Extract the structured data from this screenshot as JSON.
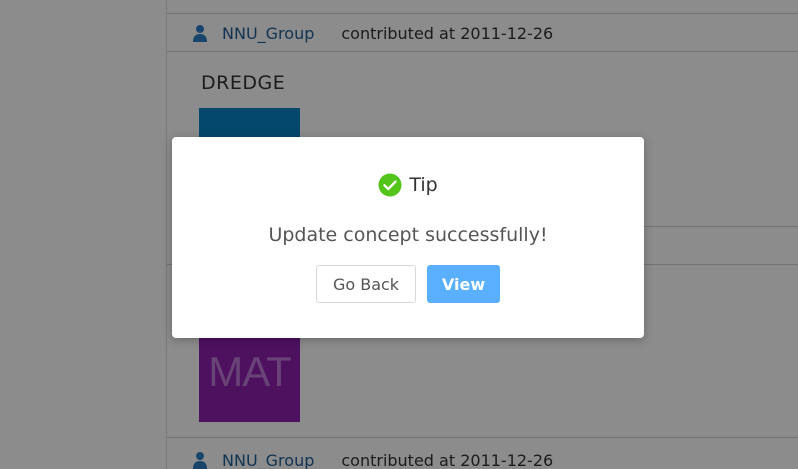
{
  "contributions": [
    {
      "user": "NNU_Group",
      "text": "contributed at 2011-12-26"
    },
    {
      "user": "NNU_Group",
      "text": "contributed at 2011-12-26"
    }
  ],
  "concept": {
    "title": "DREDGE",
    "thumb_blue_color": "#0a84c6",
    "thumb_purple_color": "#8c1fb0",
    "thumb_purple_label": "MAT"
  },
  "icons": {
    "user": "user-icon",
    "success": "check-circle-icon"
  },
  "dialog": {
    "title": "Tip",
    "message": "Update concept successfully!",
    "back_label": "Go Back",
    "view_label": "View",
    "accent_color": "#5aafff",
    "success_color": "#52c41a"
  }
}
